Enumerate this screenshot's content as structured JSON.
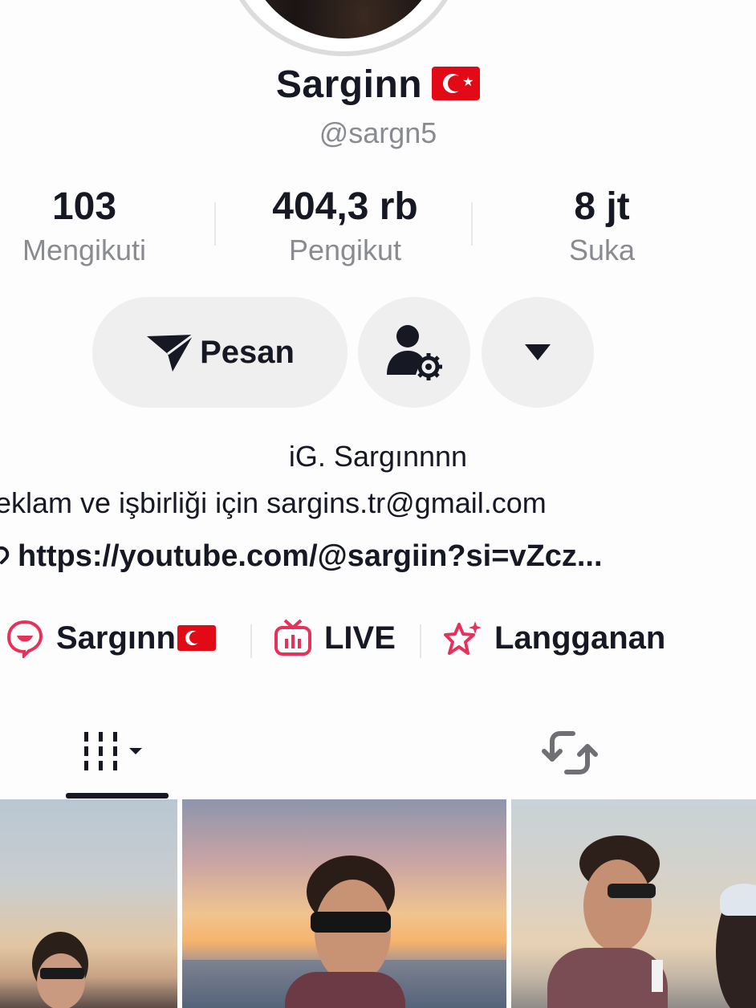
{
  "profile": {
    "name": "Sarginn",
    "handle": "@sargn5"
  },
  "stats": [
    {
      "value": "103",
      "label": "Mengikuti"
    },
    {
      "value": "404,3 rb",
      "label": "Pengikut"
    },
    {
      "value": "8 jt",
      "label": "Suka"
    }
  ],
  "actions": {
    "message_label": "Pesan"
  },
  "bio": {
    "line1": "iG.  Sargınnnn",
    "line2": "eklam ve işbirliği için sargins.tr@gmail.com",
    "link": "https://youtube.com/@sargiin?si=vZcz..."
  },
  "chips": [
    {
      "label": "Sargınn",
      "icon": "chat-bubble-icon"
    },
    {
      "label": "LIVE",
      "icon": "tv-live-icon"
    },
    {
      "label": "Langganan",
      "icon": "star-sparkle-icon"
    }
  ],
  "colors": {
    "accent": "#e5325b",
    "text": "#161823",
    "muted": "#8a8b91",
    "button_bg": "#efefef"
  }
}
